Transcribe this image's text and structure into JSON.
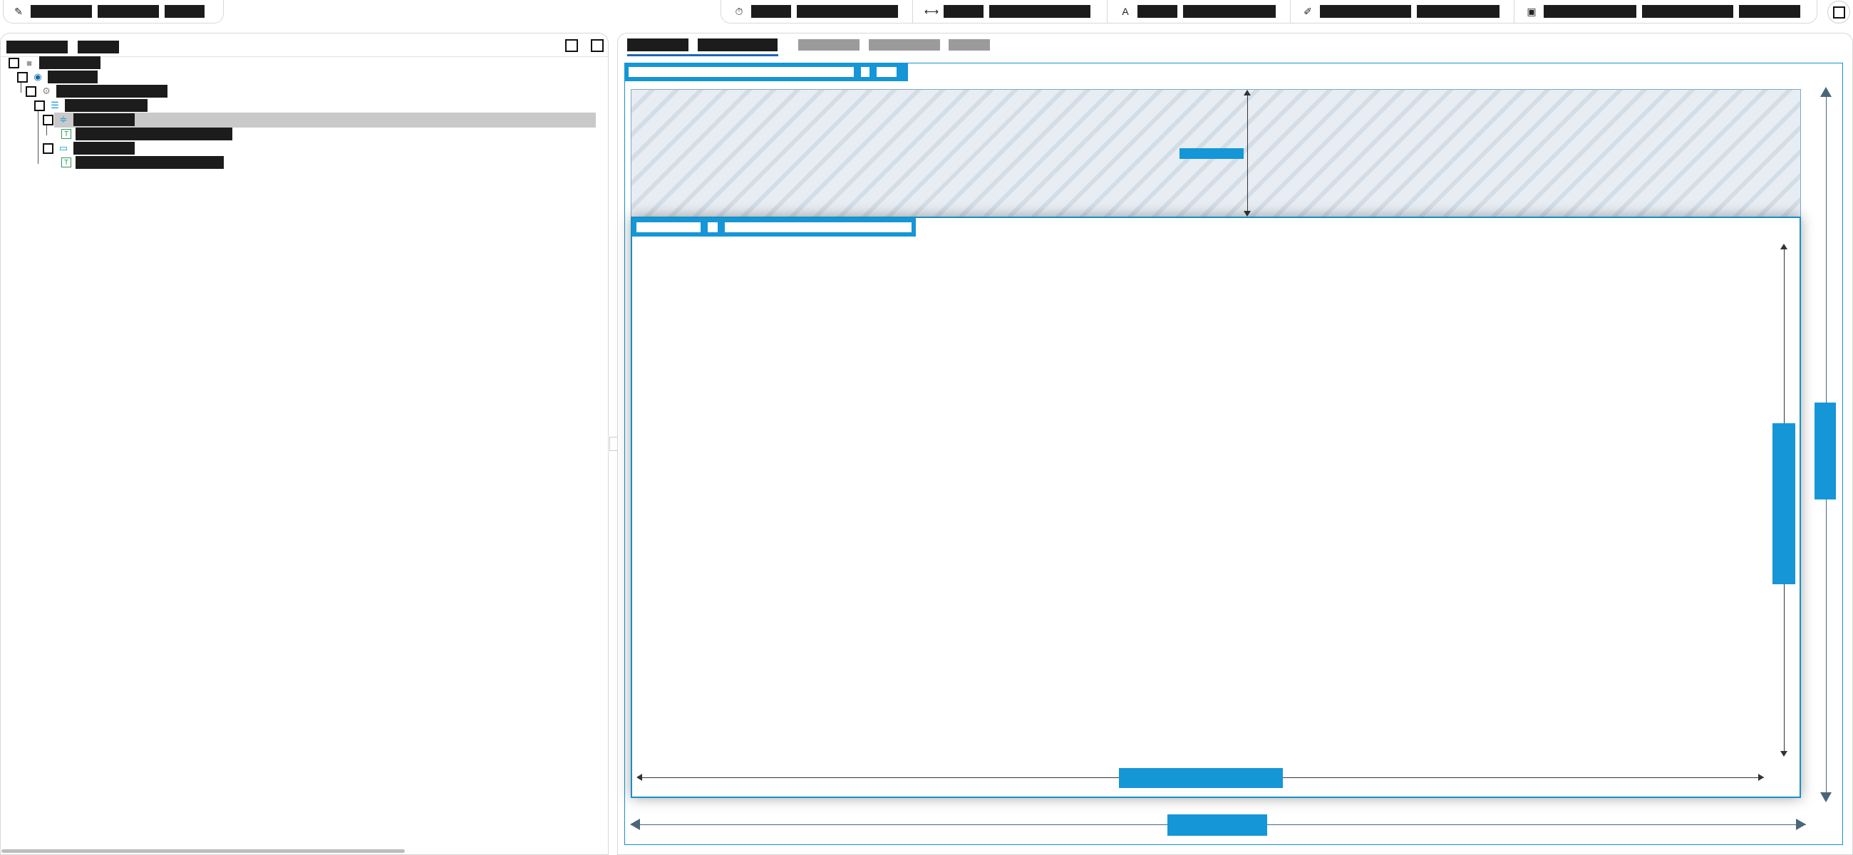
{
  "colors": {
    "accent": "#1596d6",
    "border_blue": "#1690c8",
    "tab_underline": "#1a66b8",
    "selected_row": "#c9c9c9"
  },
  "toolbar": {
    "left": {
      "icon": "magic-wand-icon",
      "items": [
        "████████",
        "████████",
        "█████"
      ]
    },
    "right": [
      {
        "icon": "timer-icon",
        "items": [
          "█████",
          "████████████"
        ]
      },
      {
        "icon": "width-icon",
        "items": [
          "█████",
          "████████████"
        ]
      },
      {
        "icon": "text-style-icon",
        "items": [
          "█████",
          "███████████"
        ]
      },
      {
        "icon": "pen-icon",
        "items": [
          "████████████",
          "███▁██████"
        ]
      },
      {
        "icon": "image-icon",
        "items": [
          "████████████",
          "████████████",
          "████████"
        ]
      }
    ],
    "corner_icon": "panel-toggle-icon"
  },
  "left_panel": {
    "header": [
      "████████",
      "█████"
    ],
    "tree": [
      {
        "label": "████████",
        "icon": "folder-icon",
        "depth": 0
      },
      {
        "label": "████▁▁▁",
        "icon": "circle-icon",
        "depth": 1
      },
      {
        "label": "████████████▁▁▁",
        "icon": "gear-icon",
        "depth": 2
      },
      {
        "label": "███████████",
        "icon": "layout-icon",
        "depth": 3
      },
      {
        "label": "████████",
        "icon": "align-icon",
        "depth": 4,
        "selected": true
      },
      {
        "label": "██████ █████████ █████████",
        "icon": "text-icon",
        "depth": 5
      },
      {
        "label": "█▁▁▁████",
        "icon": "window-icon",
        "depth": 4
      },
      {
        "label": "██████ █████████ ████████",
        "icon": "text-icon",
        "depth": 5
      }
    ]
  },
  "right_panel": {
    "tabs": [
      {
        "label": "████████",
        "active": false
      },
      {
        "label": "███▁██████",
        "active": true
      },
      {
        "label": "████████",
        "active": false
      },
      {
        "label": "██████████",
        "active": false
      },
      {
        "label": "█████",
        "active": false
      }
    ],
    "canvas": {
      "outer_tag": [
        "████████████████████████████",
        "█",
        "███"
      ],
      "content_tag": [
        "████████",
        "█",
        "████████████████████"
      ],
      "margin_value": "███████",
      "content_width": "████████████",
      "content_height": "████████████",
      "outer_width": "██████████",
      "outer_height": "████████"
    }
  }
}
